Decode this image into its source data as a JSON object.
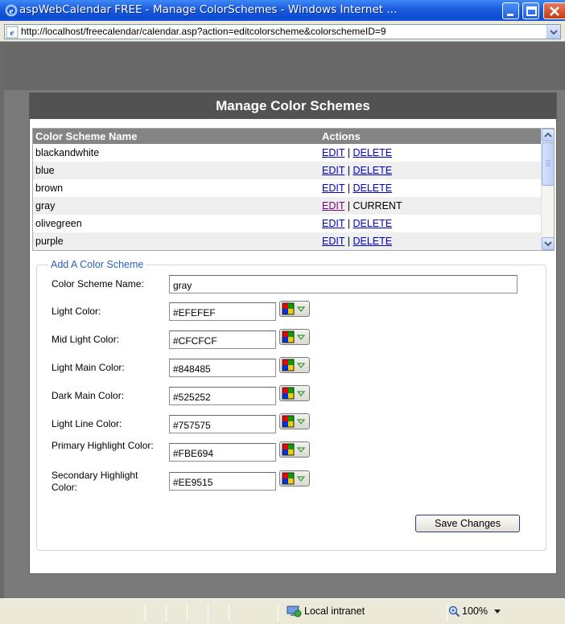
{
  "window": {
    "title": "aspWebCalendar FREE - Manage ColorSchemes - Windows Internet ...",
    "url": "http://localhost/freecalendar/calendar.asp?action=editcolorscheme&colorschemeID=9"
  },
  "dialog": {
    "title": "Manage Color Schemes",
    "list": {
      "col_name": "Color Scheme Name",
      "col_actions": "Actions",
      "rows": [
        {
          "name": "blackandwhite",
          "edit": "EDIT",
          "sep": "|",
          "action": "DELETE"
        },
        {
          "name": "blue",
          "edit": "EDIT",
          "sep": "|",
          "action": "DELETE"
        },
        {
          "name": "brown",
          "edit": "EDIT",
          "sep": "|",
          "action": "DELETE"
        },
        {
          "name": "gray",
          "edit": "EDIT",
          "sep": "|",
          "action": "CURRENT"
        },
        {
          "name": "olivegreen",
          "edit": "EDIT",
          "sep": "|",
          "action": "DELETE"
        },
        {
          "name": "purple",
          "edit": "EDIT",
          "sep": "|",
          "action": "DELETE"
        }
      ]
    },
    "form": {
      "legend": "Add A Color Scheme",
      "name_label": "Color Scheme Name:",
      "name_value": "gray",
      "fields": [
        {
          "label": "Light Color:",
          "value": "#EFEFEF"
        },
        {
          "label": "Mid Light Color:",
          "value": "#CFCFCF"
        },
        {
          "label": "Light Main Color:",
          "value": "#848485"
        },
        {
          "label": "Dark Main Color:",
          "value": "#525252"
        },
        {
          "label": "Light Line Color:",
          "value": "#757575"
        },
        {
          "label": "Primary Highlight Color:",
          "value": "#FBE694"
        },
        {
          "label": "Secondary Highlight Color:",
          "value": "#EE9515"
        }
      ],
      "save_label": "Save Changes"
    }
  },
  "status": {
    "zone": "Local intranet",
    "zoom": "100%"
  },
  "colors": {
    "header_bg": "#525252",
    "list_header_bg": "#848485",
    "row_alt_bg": "#efefef",
    "legend_text": "#2a62b8"
  }
}
